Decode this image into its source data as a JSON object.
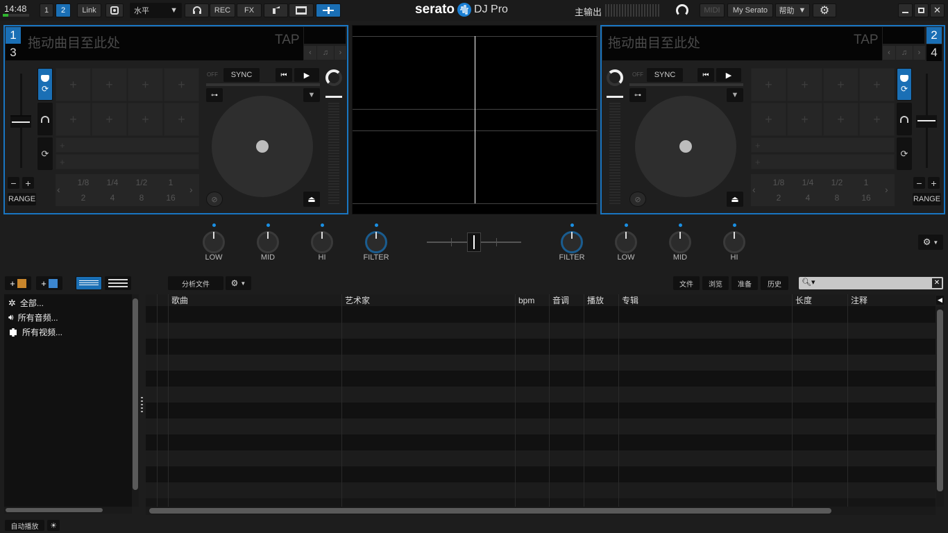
{
  "topbar": {
    "clock": "14:48",
    "deck_layout_1": "1",
    "deck_layout_2": "2",
    "link_label": "Link",
    "orientation_value": "水平",
    "rec_label": "REC",
    "fx_label": "FX",
    "brand": "serato",
    "brand_product": "DJ Pro",
    "master_output_label": "主输出",
    "midi_label": "MIDI",
    "my_serato_label": "My Serato",
    "help_label": "帮助"
  },
  "deck_left": {
    "number_top": "1",
    "number_bottom": "3",
    "title_placeholder": "拖动曲目至此处",
    "tap_label": "TAP",
    "off_label": "OFF",
    "sync_label": "SYNC",
    "range_label": "RANGE",
    "pitch_minus": "−",
    "pitch_plus": "+",
    "loops_top": [
      "1/8",
      "1/4",
      "1/2",
      "1"
    ],
    "loops_bottom": [
      "2",
      "4",
      "8",
      "16"
    ]
  },
  "deck_right": {
    "number_top": "2",
    "number_bottom": "4",
    "title_placeholder": "拖动曲目至此处",
    "tap_label": "TAP",
    "off_label": "OFF",
    "sync_label": "SYNC",
    "range_label": "RANGE",
    "pitch_minus": "−",
    "pitch_plus": "+",
    "loops_top": [
      "1/8",
      "1/4",
      "1/2",
      "1"
    ],
    "loops_bottom": [
      "2",
      "4",
      "8",
      "16"
    ]
  },
  "mixer": {
    "left_knobs": [
      "LOW",
      "MID",
      "HI",
      "FILTER"
    ],
    "right_knobs": [
      "FILTER",
      "LOW",
      "MID",
      "HI"
    ]
  },
  "library": {
    "analyze_label": "分析文件",
    "tabs": [
      "文件",
      "浏览",
      "准备",
      "历史"
    ],
    "crates": [
      "全部...",
      "所有音频...",
      "所有视频..."
    ],
    "columns": [
      "歌曲",
      "艺术家",
      "bpm",
      "音调",
      "播放",
      "专辑",
      "长度",
      "注释"
    ],
    "autoplay_label": "自动播放"
  },
  "colors": {
    "accent": "#1a6fb5",
    "deck_border": "#1976c2"
  }
}
